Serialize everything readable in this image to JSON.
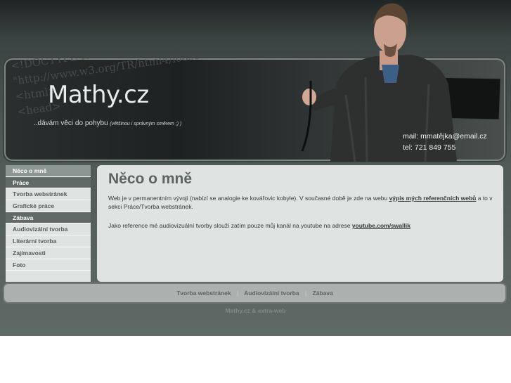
{
  "header": {
    "logo": "Mathy.cz",
    "tagline_main": "..dávám věci do pohybu",
    "tagline_small": "(většinou i správným směrem ;) )",
    "code_background": "<!DOCTYPE HTML PUBLIC \"-//W3C//DTD HTML 4.\n\"http://www.w3.org/TR/html4/loose.dtd\">\n<html>\n<head>",
    "contact_mail": "mail: mmatějka@email.cz",
    "contact_phone": "tel: 721 849 755"
  },
  "sidebar": {
    "items": [
      {
        "label": "Něco o mně"
      },
      {
        "label": "Práce"
      },
      {
        "label": "Tvorba webstránek"
      },
      {
        "label": "Grafické práce"
      },
      {
        "label": "Zábava"
      },
      {
        "label": "Audiovizální tvorba"
      },
      {
        "label": "Literární tvorba"
      },
      {
        "label": "Zajímavosti"
      },
      {
        "label": "Foto"
      }
    ]
  },
  "main": {
    "title": "Něco o mně",
    "para1_text": "Web je v permanentním vývoji (nabízí se analogie ke kovářovic kobyle). V současné době je zde na webu",
    "para1_link": "výpis mých referenčních webů",
    "para1_tail": "a to v sekci Práce/Tvorba webstránek.",
    "para2_text": "Jako reference mé audiovizuální tvorby slouží zatím pouze můj kanál na youtube na adrese",
    "para2_link": "youtube.com/swallik"
  },
  "footer": {
    "links": [
      "Tvorba webstránek",
      "Audiovizální tvorba",
      "Zábava"
    ],
    "copyright": "Mathy.cz & extra-web"
  }
}
